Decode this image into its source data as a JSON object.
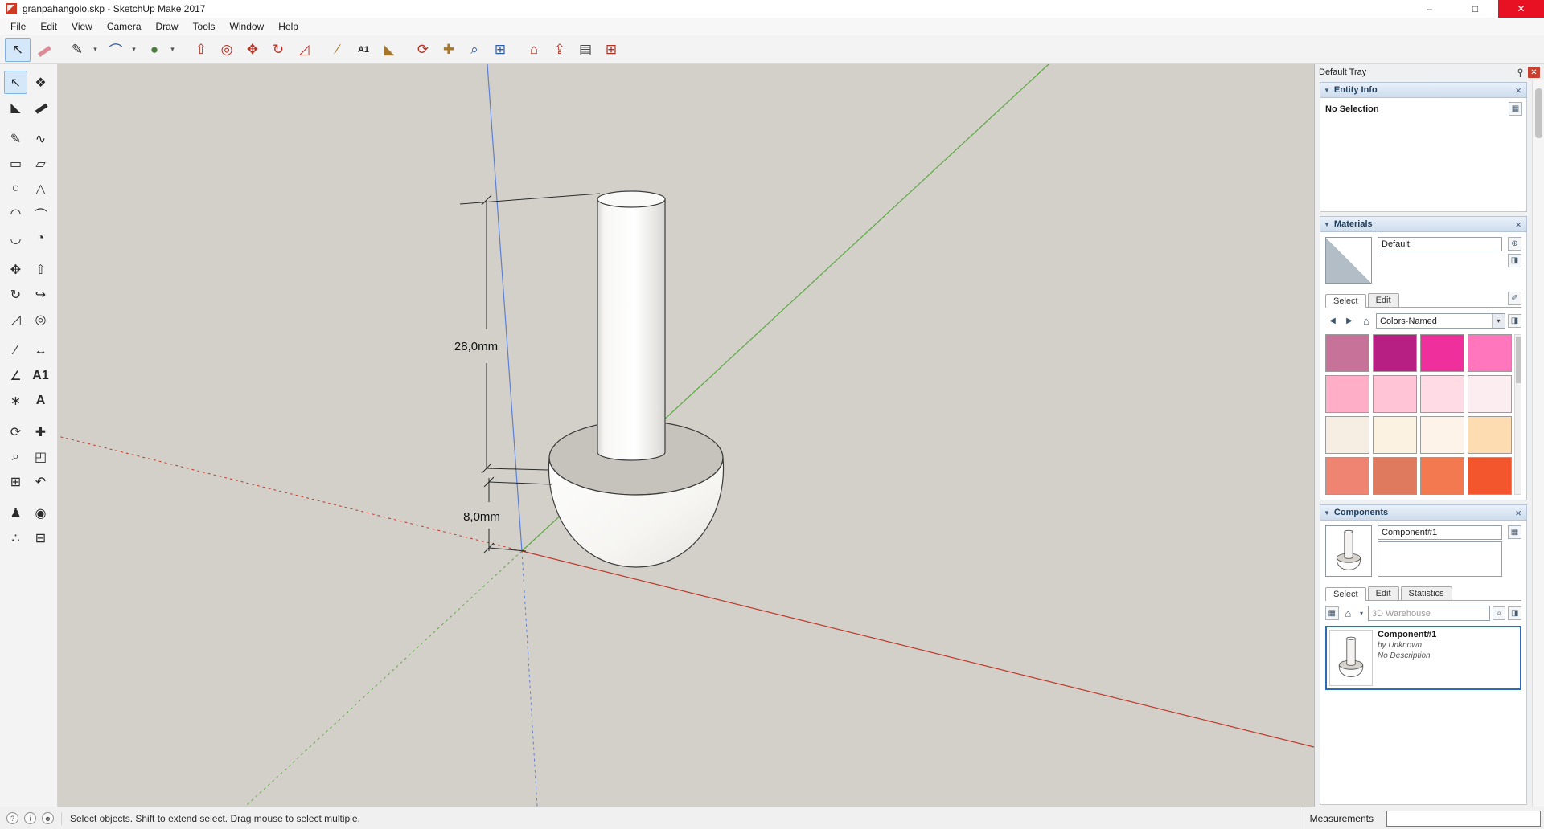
{
  "window": {
    "title": "granpahangolo.skp - SketchUp Make 2017"
  },
  "menu": {
    "items": [
      "File",
      "Edit",
      "View",
      "Camera",
      "Draw",
      "Tools",
      "Window",
      "Help"
    ]
  },
  "icons": {
    "minimize": "–",
    "maximize": "□",
    "close": "✕",
    "dropdown": "▾",
    "collapse": "▼",
    "panel_close": "×",
    "select": "↖",
    "make_component": "❖",
    "paint": "◣",
    "eraser": "▬",
    "line": "✎",
    "freehand": "∿",
    "rectangle": "▭",
    "rotated_rectangle": "▱",
    "circle": "○",
    "polygon": "△",
    "arc": "⌒",
    "arc2": "◠",
    "arc3": "◡",
    "pie": "◔",
    "move": "✥",
    "push_pull": "⇧",
    "rotate": "↻",
    "follow_me": "↪",
    "scale": "◿",
    "offset": "◎",
    "tape": "∕",
    "dimension": "↔",
    "protractor": "∠",
    "text": "A1",
    "axes": "∗",
    "text3d": "A",
    "orbit": "⟳",
    "pan": "✚",
    "zoom": "⌕",
    "zoom_window": "◰",
    "zoom_extents": "⊞",
    "previous": "↶",
    "position_camera": "♟",
    "look_around": "◉",
    "walk": "∴",
    "section": "⊟",
    "shapes": "●",
    "warehouse": "⌂",
    "share": "⇪",
    "ext_warehouse": "⊞",
    "layout": "▤",
    "back": "◀",
    "forward": "▶",
    "home": "⌂",
    "magnifier": "⌕",
    "eyedropper": "✐",
    "secondary_pane": "◨",
    "create_material": "⊕",
    "detail": "▦",
    "viewopts": "▦",
    "status_help": "?",
    "status_info": "i",
    "status_user": "☻"
  },
  "viewport": {
    "dimensions": {
      "height_label": "28,0mm",
      "base_label": "8,0mm"
    },
    "axis_colors": {
      "red": "#c0392b",
      "green": "#5ba843",
      "blue": "#5b7fd4"
    }
  },
  "tray": {
    "title": "Default Tray",
    "entity_info": {
      "title": "Entity Info",
      "message": "No Selection"
    },
    "materials": {
      "title": "Materials",
      "current_name": "Default",
      "tabs": {
        "select": "Select",
        "edit": "Edit"
      },
      "collection": "Colors-Named",
      "swatches": [
        "#c77298",
        "#b81f82",
        "#ef2f9b",
        "#ff76bd",
        "#ffaec8",
        "#ffc4d6",
        "#ffdbe5",
        "#fcedf1",
        "#f7eee3",
        "#fbf2e2",
        "#fdf3e8",
        "#fcdcb0",
        "#ef8472",
        "#e07a5e",
        "#f37950",
        "#f3562d"
      ]
    },
    "components": {
      "title": "Components",
      "name_value": "Component#1",
      "tabs": {
        "select": "Select",
        "edit": "Edit",
        "statistics": "Statistics"
      },
      "search_placeholder": "3D Warehouse",
      "list": [
        {
          "name": "Component#1",
          "author": "by Unknown",
          "description": "No Description"
        }
      ]
    }
  },
  "statusbar": {
    "hint": "Select objects. Shift to extend select. Drag mouse to select multiple.",
    "measurements_label": "Measurements"
  }
}
